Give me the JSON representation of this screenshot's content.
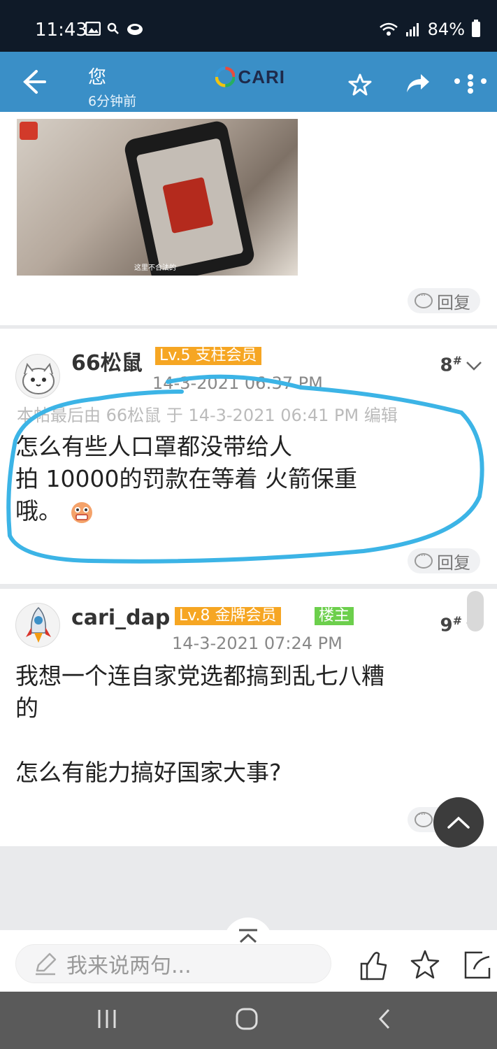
{
  "status_bar": {
    "time": "11:43",
    "battery": "84%",
    "icons": [
      "image-icon",
      "search-icon",
      "cloud-icon",
      "wifi-icon",
      "signal-icon",
      "battery-icon"
    ]
  },
  "header": {
    "title": "您",
    "subtitle": "6分钟前",
    "logo_text": "CARI",
    "background": "#3a8fc7"
  },
  "posts": [
    {
      "image_caption": "这里不合法的",
      "reply_label": "回复"
    },
    {
      "username": "66松鼠",
      "level_badge": "Lv.5 支柱会员",
      "floor": "8",
      "floor_mark": "#",
      "date": "14-3-2021 06:37 PM",
      "edited_note": "本帖最后由 66松鼠 于 14-3-2021 06:41 PM 编辑",
      "content": "怎么有些人口罩都没带给人\n拍 10000的罚款在等着 火箭保重\n哦。",
      "emoji": "scared-face-emoji",
      "reply_label": "回复",
      "annotation_color": "#3cb4e6"
    },
    {
      "username": "cari_dap",
      "level_badge": "Lv.8 金牌会员",
      "owner_badge": "楼主",
      "floor": "9",
      "floor_mark": "#",
      "date": "14-3-2021 07:24 PM",
      "content": "我想一个连自家党选都搞到乱七八糟\n的\n\n怎么有能力搞好国家大事?",
      "reply_label": "回复"
    }
  ],
  "composer": {
    "placeholder": "我来说两句..."
  },
  "colors": {
    "badge_orange": "#f6a623",
    "badge_green": "#6ccf4c",
    "nav_bar": "#5a5a5a"
  }
}
